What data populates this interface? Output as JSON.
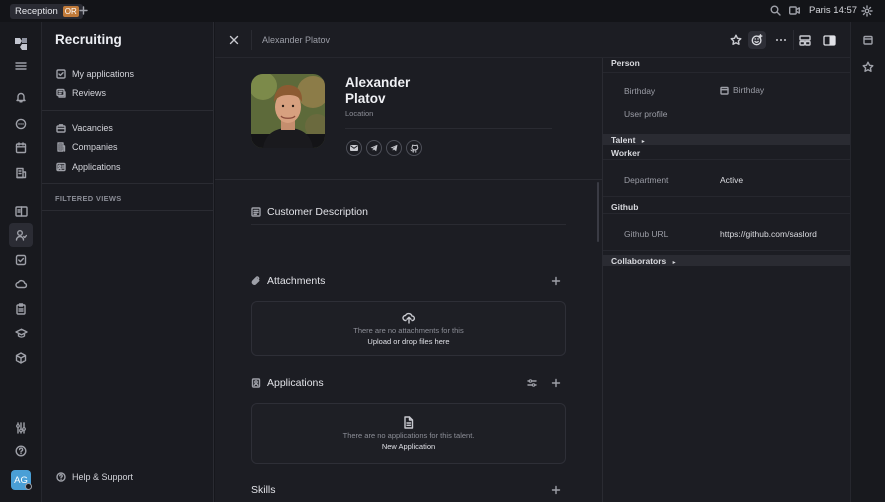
{
  "topbar": {
    "tab_label": "Reception",
    "tab_badge": "OR",
    "location": "Paris",
    "time": "14:57"
  },
  "nav": {
    "title": "Recruiting",
    "items_top": [
      {
        "label": "My applications",
        "icon": "checkbox-icon"
      },
      {
        "label": "Reviews",
        "icon": "reviews-icon"
      }
    ],
    "items_mid": [
      {
        "label": "Vacancies",
        "icon": "briefcase-icon"
      },
      {
        "label": "Companies",
        "icon": "building-icon"
      },
      {
        "label": "Applications",
        "icon": "applications-icon"
      }
    ],
    "filtered_views": "FILTERED VIEWS",
    "help": "Help & Support"
  },
  "user": {
    "initials": "AG",
    "avatar_color": "#4a9fd6"
  },
  "header": {
    "breadcrumb": "Alexander Platov"
  },
  "profile": {
    "first_name": "Alexander",
    "last_name": "Platov",
    "location_placeholder": "Location"
  },
  "sections": {
    "customer_description": "Customer Description",
    "attachments": "Attachments",
    "attachments_empty": "There are no attachments for this",
    "attachments_upload": "Upload or drop files here",
    "applications": "Applications",
    "applications_empty": "There are no applications for this talent.",
    "applications_new": "New Application",
    "skills": "Skills"
  },
  "right_panel": {
    "person": "Person",
    "birthday_label": "Birthday",
    "birthday_value": "Birthday",
    "user_profile_label": "User profile",
    "talent": "Talent",
    "worker": "Worker",
    "department_label": "Department",
    "department_value": "Active",
    "github": "Github",
    "github_url_label": "Github URL",
    "github_url_value": "https://github.com/saslord",
    "collaborators": "Collaborators"
  },
  "colors": {
    "accent_badge": "#c07a3a",
    "background": "#16171c"
  }
}
